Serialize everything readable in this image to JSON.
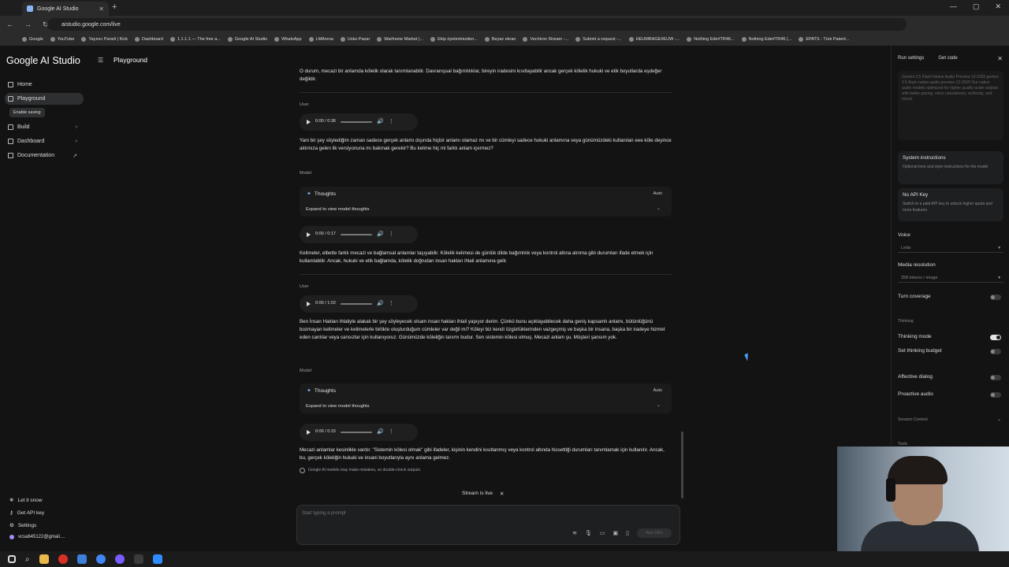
{
  "browser": {
    "tab_title": "Google AI Studio",
    "url": "aistudio.google.com/live",
    "bookmarks": [
      "Google",
      "YouTube",
      "Yayıncı Paneli | Kick",
      "Dashboard",
      "1.1.1.1 — The free a...",
      "Google AI Studio",
      "WhatsApp",
      "LMArena",
      "Usko Pazar",
      "Warframe Market |...",
      "Ekip üyelerimizden...",
      "Beyaz ekran",
      "Vechiron Stream -...",
      "Submit a request -...",
      "HEUMRAGE#EUW -...",
      "Nothing Ede#TR46...",
      "Nothing Ede#TR46 (...",
      "EPATS - Türk Patent..."
    ]
  },
  "sidebar": {
    "logo": "Google AI Studio",
    "items": [
      {
        "label": "Home"
      },
      {
        "label": "Playground"
      },
      {
        "label": "Build"
      },
      {
        "label": "Dashboard"
      },
      {
        "label": "Documentation"
      }
    ],
    "enable_saving": "Enable saving",
    "bottom": [
      {
        "label": "Let it snow"
      },
      {
        "label": "Get API key"
      },
      {
        "label": "Settings"
      },
      {
        "label": "vcsa645122@gmail...."
      }
    ]
  },
  "header": {
    "title": "Playground"
  },
  "chat": {
    "top_text": "O durum, mecazi bir anlamda kölelik olarak tanımlanabilir. Davranışsal bağımlılıklar, bireyin iradesini kısıtlayabilir ancak gerçek kölelik hukuki ve etik boyutlarda eşdeğer değildir.",
    "user_label": "User",
    "model_label": "Model",
    "thoughts_label": "Thoughts",
    "auto_label": "Auto",
    "expand_label": "Expand to view model thoughts",
    "audios": [
      "0:00 / 0:36",
      "0:00 / 0:17",
      "0:00 / 1:02",
      "0:00 / 0:15"
    ],
    "user1": "Yani bir şey söylediğim zaman sadece gerçek anlamı dışında hiçbir anlamı olamaz mı ve bir cümleyi sadece hukuki anlamına veya günümüzdeki kullanılan eee köle deyince aklımıza gelen ilk versiyonuna mı bakmak gerekir? Bu kelime hiç mi farklı anlam içermez?",
    "model1": "Kelimeler, elbette farklı mecazi ve bağlamsal anlamlar taşıyabilir. Kölelik kelimesi de günlük dilde bağımlılık veya kontrol altına alınma gibi durumları ifade etmek için kullanılabilir. Ancak, hukuki ve etik bağlamda, kölelik doğrudan insan hakları ihlali anlamına gelir.",
    "user2": "Ben İnsan Hakları ihlaliyle alakalı bir şey söyleyecek olsam insan hakları ihlali yapıyor derim. Çünkü bunu açıklayabilecek daha geniş kapsamlı anlamı, bütünlüğünü bozmayan kelimeler ve kelimelerle birlikte oluşturduğum cümleler var değil mi? Köleyi biz kendi özgürlüklerinden vazgeçmiş ve başka bir insana, başka bir iradeye hizmet eden canlılar veya cansızlar için kullanıyoruz. Günümüzde köleliğin tanımı budur. Sen sistemin kölesi olmuş. Mecazi anlam şu. Müşteri şansım yok.",
    "model2": "Mecazi anlamlar kesinlikle vardır. \"Sistemin kölesi olmak\" gibi ifadeler, kişinin kendini kısıtlanmış veya kontrol altında hissettiği durumları tanımlamak için kullanılır. Ancak, bu, gerçek köleliğin hukuki ve insani boyutlarıyla aynı anlama gelmez.",
    "disclaimer": "Google AI models may make mistakes, so double-check outputs.",
    "stream_status": "Stream is live",
    "prompt_placeholder": "Start typing a prompt",
    "run_label": "Run Ctrl+"
  },
  "run_settings": {
    "title": "Run settings",
    "get_code": "Get code",
    "model_card": "Gemini 2.5 Flash Native Audio Preview 12-2025 gemini-2.5-flash-native-audio-preview-12-2025 Our native audio models optimized for higher quality audio outputs with better pacing, voice naturalness, verbosity, and mood.",
    "system_title": "System instructions",
    "system_desc": "Optional tone and style instructions for the model",
    "apikey_title": "No API Key",
    "apikey_desc": "Switch to a paid API key to unlock higher quota and more features.",
    "voice_label": "Voice",
    "voice_value": "Leda",
    "media_label": "Media resolution",
    "media_value": "258 tokens / image",
    "turn_coverage": "Turn coverage",
    "thinking": "Thinking",
    "thinking_mode": "Thinking mode",
    "thinking_budget": "Set thinking budget",
    "affective": "Affective dialog",
    "proactive": "Proactive audio",
    "session_context": "Session Context",
    "tools": "Tools"
  },
  "colors": {
    "accent": "#8ab4f8",
    "background": "#131314",
    "card": "#1e1f20"
  }
}
